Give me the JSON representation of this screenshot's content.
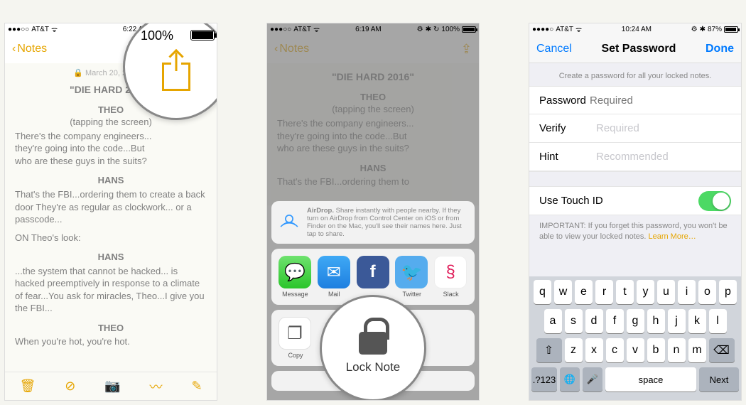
{
  "circle1": {
    "battery_label": "100%"
  },
  "phone1": {
    "status": {
      "carrier": "AT&T",
      "time": "6:22 AM"
    },
    "nav": {
      "back": "Notes"
    },
    "note": {
      "date": "March 20, 2016 at",
      "title": "\"DIE HARD 2016\"",
      "s1_name": "THEO",
      "s1_action": "(tapping the screen)",
      "s1_body": "There's the company engineers...\nthey're going into the code...But\nwho are these guys in the suits?",
      "s2_name": "HANS",
      "s2_body": "That's the FBI...ordering them to create a back door  They're as regular as clockwork... or a passcode...",
      "s3_aside": "ON Theo's look:",
      "s4_name": "HANS",
      "s4_body": "...the system that cannot be hacked... is hacked preemptively in response to a climate of fear...You ask for miracles, Theo...I give you the FBI...",
      "s5_name": "THEO",
      "s5_body": "When you're hot, you're hot."
    }
  },
  "phone2": {
    "status": {
      "carrier": "AT&T",
      "time": "6:19 AM",
      "batt": "100%"
    },
    "nav": {
      "back": "Notes"
    },
    "note": {
      "title": "\"DIE HARD 2016\"",
      "s1_name": "THEO",
      "s1_action": "(tapping the screen)",
      "s1_body": "There's the company engineers...\nthey're going into the code...But\nwho are these guys in the suits?",
      "s2_name": "HANS",
      "s2_body": "That's the FBI...ordering them to"
    },
    "airdrop": {
      "title": "AirDrop.",
      "body": "Share instantly with people nearby. If they turn on AirDrop from Control Center on iOS or from Finder on the Mac, you'll see their names here. Just tap to share."
    },
    "apps": {
      "a1": "Message",
      "a2": "Mail",
      "a3": "Facebook",
      "a4": "Twitter",
      "a5": "Slack"
    },
    "actions": {
      "a1": "Copy"
    },
    "lock_label": "Lock Note"
  },
  "phone3": {
    "status": {
      "carrier": "AT&T",
      "time": "10:24 AM",
      "batt": "87%"
    },
    "nav": {
      "cancel": "Cancel",
      "title": "Set Password",
      "done": "Done"
    },
    "hint_section": "Create a password for all your locked notes.",
    "fields": {
      "password_label": "Password",
      "password_ph": "Required",
      "verify_label": "Verify",
      "verify_ph": "Required",
      "hint_label": "Hint",
      "hint_ph": "Recommended"
    },
    "touchid_label": "Use Touch ID",
    "footnote": "IMPORTANT: If you forget this password, you won't be able to view your locked notes. ",
    "learn_more": "Learn More…",
    "kbd": {
      "r1": [
        "q",
        "w",
        "e",
        "r",
        "t",
        "y",
        "u",
        "i",
        "o",
        "p"
      ],
      "r2": [
        "a",
        "s",
        "d",
        "f",
        "g",
        "h",
        "j",
        "k",
        "l"
      ],
      "r3": [
        "z",
        "x",
        "c",
        "v",
        "b",
        "n",
        "m"
      ],
      "sym": ".?123",
      "space": "space",
      "next": "Next"
    }
  }
}
